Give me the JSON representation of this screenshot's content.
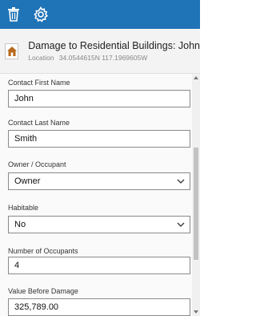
{
  "toolbar": {
    "delete_icon": "trash-icon",
    "settings_icon": "gear-icon"
  },
  "header": {
    "title": "Damage to Residential Buildings: John",
    "location_label": "Location",
    "location_value": "34.0544615N 117.1969605W",
    "icon": "house-icon"
  },
  "form": {
    "fields": [
      {
        "label": "Contact First Name",
        "value": "John",
        "type": "text"
      },
      {
        "label": "Contact Last Name",
        "value": "Smith",
        "type": "text"
      },
      {
        "label": "Owner / Occupant",
        "value": "Owner",
        "type": "select"
      },
      {
        "label": "Habitable",
        "value": "No",
        "type": "select"
      },
      {
        "label": "Number of Occupants",
        "value": "4",
        "type": "text"
      },
      {
        "label": "Value Before Damage",
        "value": "325,789.00",
        "type": "text"
      }
    ]
  },
  "colors": {
    "toolbar": "#1f73b7",
    "header_bg": "#f3f3f3",
    "form_bg": "#fafafa",
    "house_icon": "#b86a1f"
  }
}
